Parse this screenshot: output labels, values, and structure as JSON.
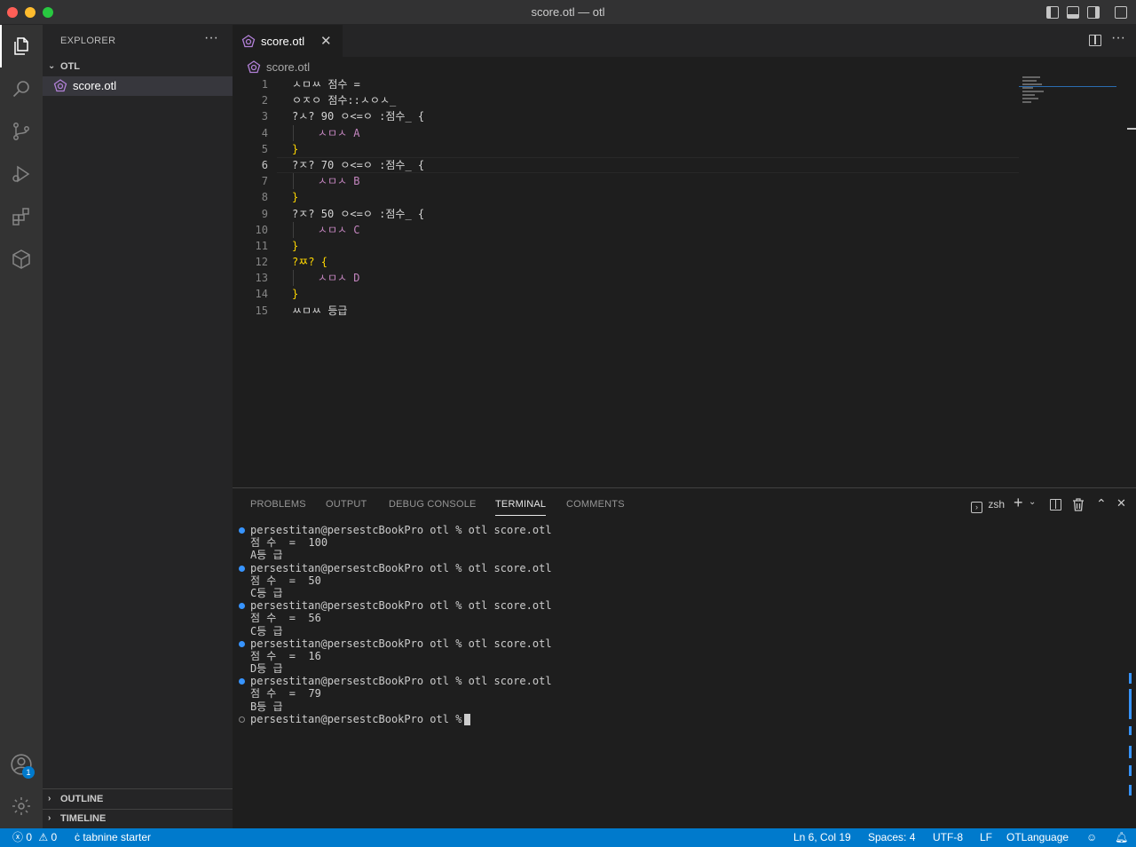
{
  "window": {
    "title": "score.otl — otl"
  },
  "activity": {
    "accounts_badge": "1"
  },
  "sidebar": {
    "header": "EXPLORER",
    "folder": "OTL",
    "file": "score.otl",
    "outline": "OUTLINE",
    "timeline": "TIMELINE"
  },
  "editor": {
    "tab_label": "score.otl",
    "breadcrumb": "score.otl",
    "lines": [
      {
        "n": "1",
        "t": "ㅅㅁㅆ 점수 ="
      },
      {
        "n": "2",
        "t": "ㅇㅈㅇ 점수::ㅅㅇㅅ_"
      },
      {
        "n": "3",
        "t": "?ㅅ? 90 ㅇ<=ㅇ :점수_ {"
      },
      {
        "n": "4",
        "t": "    ㅅㅁㅅ A"
      },
      {
        "n": "5",
        "t": "}"
      },
      {
        "n": "6",
        "t": "?ㅈ? 70 ㅇ<=ㅇ :점수_ {"
      },
      {
        "n": "7",
        "t": "    ㅅㅁㅅ B"
      },
      {
        "n": "8",
        "t": "}"
      },
      {
        "n": "9",
        "t": "?ㅈ? 50 ㅇ<=ㅇ :점수_ {"
      },
      {
        "n": "10",
        "t": "    ㅅㅁㅅ C"
      },
      {
        "n": "11",
        "t": "}"
      },
      {
        "n": "12",
        "t": "?ㅉ? {"
      },
      {
        "n": "13",
        "t": "    ㅅㅁㅅ D"
      },
      {
        "n": "14",
        "t": "}"
      },
      {
        "n": "15",
        "t": "ㅆㅁㅆ 등급"
      }
    ]
  },
  "panel": {
    "tabs": [
      "PROBLEMS",
      "OUTPUT",
      "DEBUG CONSOLE",
      "TERMINAL",
      "COMMENTS"
    ],
    "shell": "zsh",
    "terminal": [
      {
        "dot": "blue",
        "text": "persestitan@persestcBookPro otl % otl score.otl"
      },
      {
        "dot": "",
        "text": "점 수  =  100"
      },
      {
        "dot": "",
        "text": "A등 급"
      },
      {
        "dot": "blue",
        "text": "persestitan@persestcBookPro otl % otl score.otl"
      },
      {
        "dot": "",
        "text": "점 수  =  50"
      },
      {
        "dot": "",
        "text": "C등 급"
      },
      {
        "dot": "blue",
        "text": "persestitan@persestcBookPro otl % otl score.otl"
      },
      {
        "dot": "",
        "text": "점 수  =  56"
      },
      {
        "dot": "",
        "text": "C등 급"
      },
      {
        "dot": "blue",
        "text": "persestitan@persestcBookPro otl % otl score.otl"
      },
      {
        "dot": "",
        "text": "점 수  =  16"
      },
      {
        "dot": "",
        "text": "D등 급"
      },
      {
        "dot": "blue",
        "text": "persestitan@persestcBookPro otl % otl score.otl"
      },
      {
        "dot": "",
        "text": "점 수  =  79"
      },
      {
        "dot": "",
        "text": "B등 급"
      },
      {
        "dot": "hollow",
        "text": "persestitan@persestcBookPro otl % "
      }
    ]
  },
  "status": {
    "errors": "0",
    "warnings": "0",
    "tabnine": "tabnine starter",
    "position": "Ln 6, Col 19",
    "spaces": "Spaces: 4",
    "encoding": "UTF-8",
    "eol": "LF",
    "language": "OTLanguage"
  }
}
